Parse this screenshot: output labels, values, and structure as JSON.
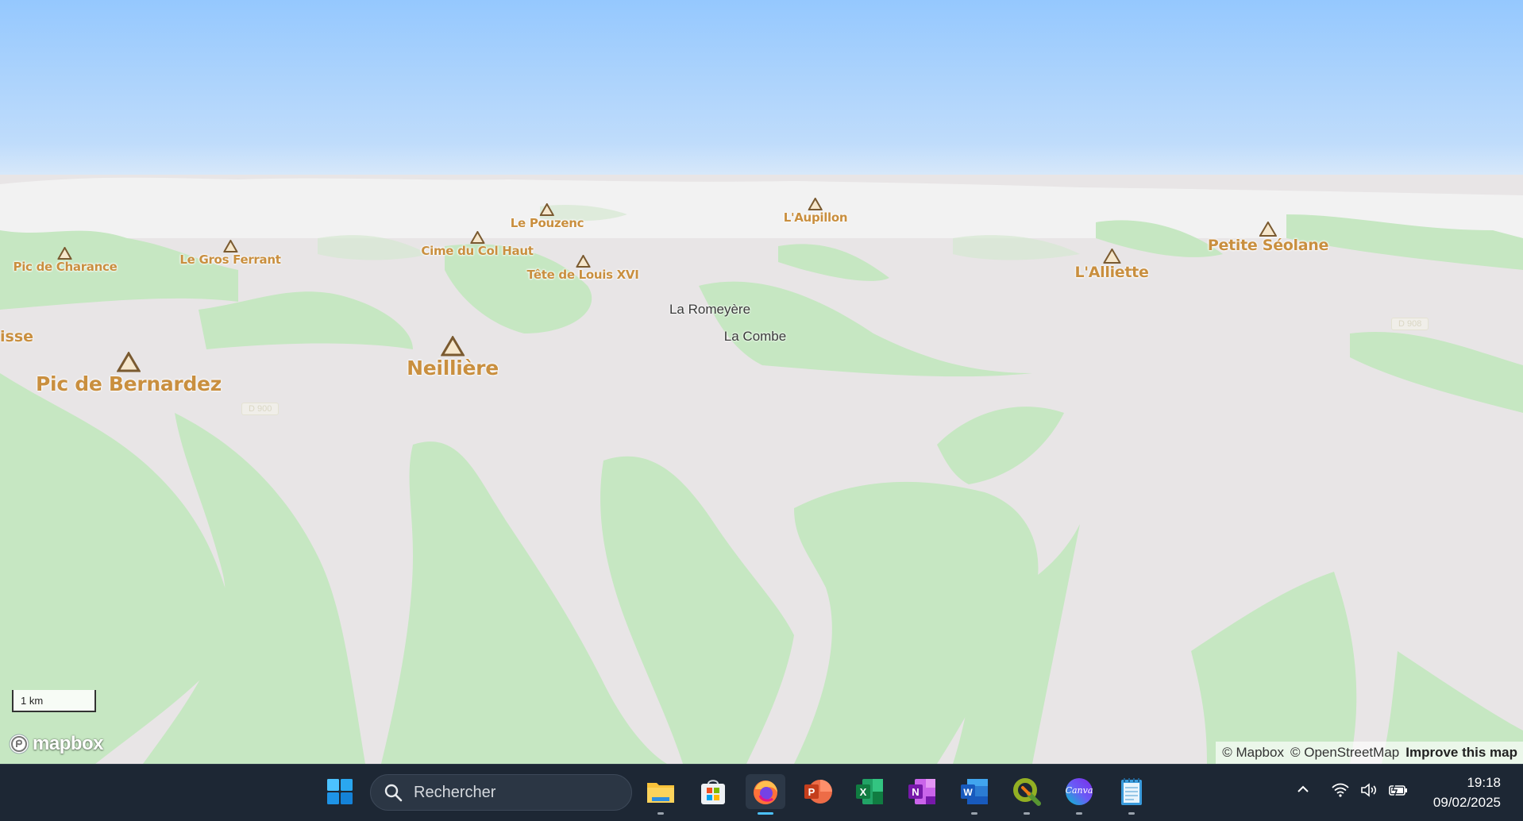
{
  "map": {
    "peaks": [
      {
        "name": "Pic de Charance",
        "size": "small"
      },
      {
        "name": "Le Gros Ferrant",
        "size": "small"
      },
      {
        "name": "Cime du Col Haut",
        "size": "small"
      },
      {
        "name": "Le Pouzenc",
        "size": "small"
      },
      {
        "name": "Tête de Louis XVI",
        "size": "small"
      },
      {
        "name": "L'Aupillon",
        "size": "small"
      },
      {
        "name": "L'Alliette",
        "size": "small"
      },
      {
        "name": "Petite Séolane",
        "size": "small"
      },
      {
        "name": "Pic de Bernardez",
        "size": "big"
      },
      {
        "name": "Neillière",
        "size": "big"
      }
    ],
    "edge_label": "isse",
    "places": [
      "La Romeyère",
      "La Combe"
    ],
    "roads": [
      "D 900",
      "D 908"
    ],
    "scale_label": "1 km",
    "logo_text": "mapbox",
    "attribution": {
      "mapbox": "© Mapbox",
      "osm": "© OpenStreetMap",
      "improve": "Improve this map"
    },
    "colors": {
      "sky_top": "#9ecbff",
      "sky_bottom": "#dcebfb",
      "forest": "#b9e3b5",
      "rock": "#e7e4e5",
      "peak_label": "#c98f3f"
    }
  },
  "taskbar": {
    "search_placeholder": "Rechercher",
    "apps": [
      {
        "name": "start",
        "icon": "windows-icon"
      },
      {
        "name": "file-explorer",
        "icon": "folder-icon"
      },
      {
        "name": "microsoft-store",
        "icon": "store-icon"
      },
      {
        "name": "firefox",
        "icon": "firefox-icon",
        "active": true
      },
      {
        "name": "powerpoint",
        "icon": "powerpoint-icon"
      },
      {
        "name": "excel",
        "icon": "excel-icon"
      },
      {
        "name": "onenote",
        "icon": "onenote-icon"
      },
      {
        "name": "word",
        "icon": "word-icon"
      },
      {
        "name": "qgis",
        "icon": "qgis-icon"
      },
      {
        "name": "canva",
        "icon": "canva-icon",
        "label": "Canva"
      },
      {
        "name": "notepad",
        "icon": "notepad-icon"
      }
    ],
    "time": "19:18",
    "date": "09/02/2025"
  }
}
